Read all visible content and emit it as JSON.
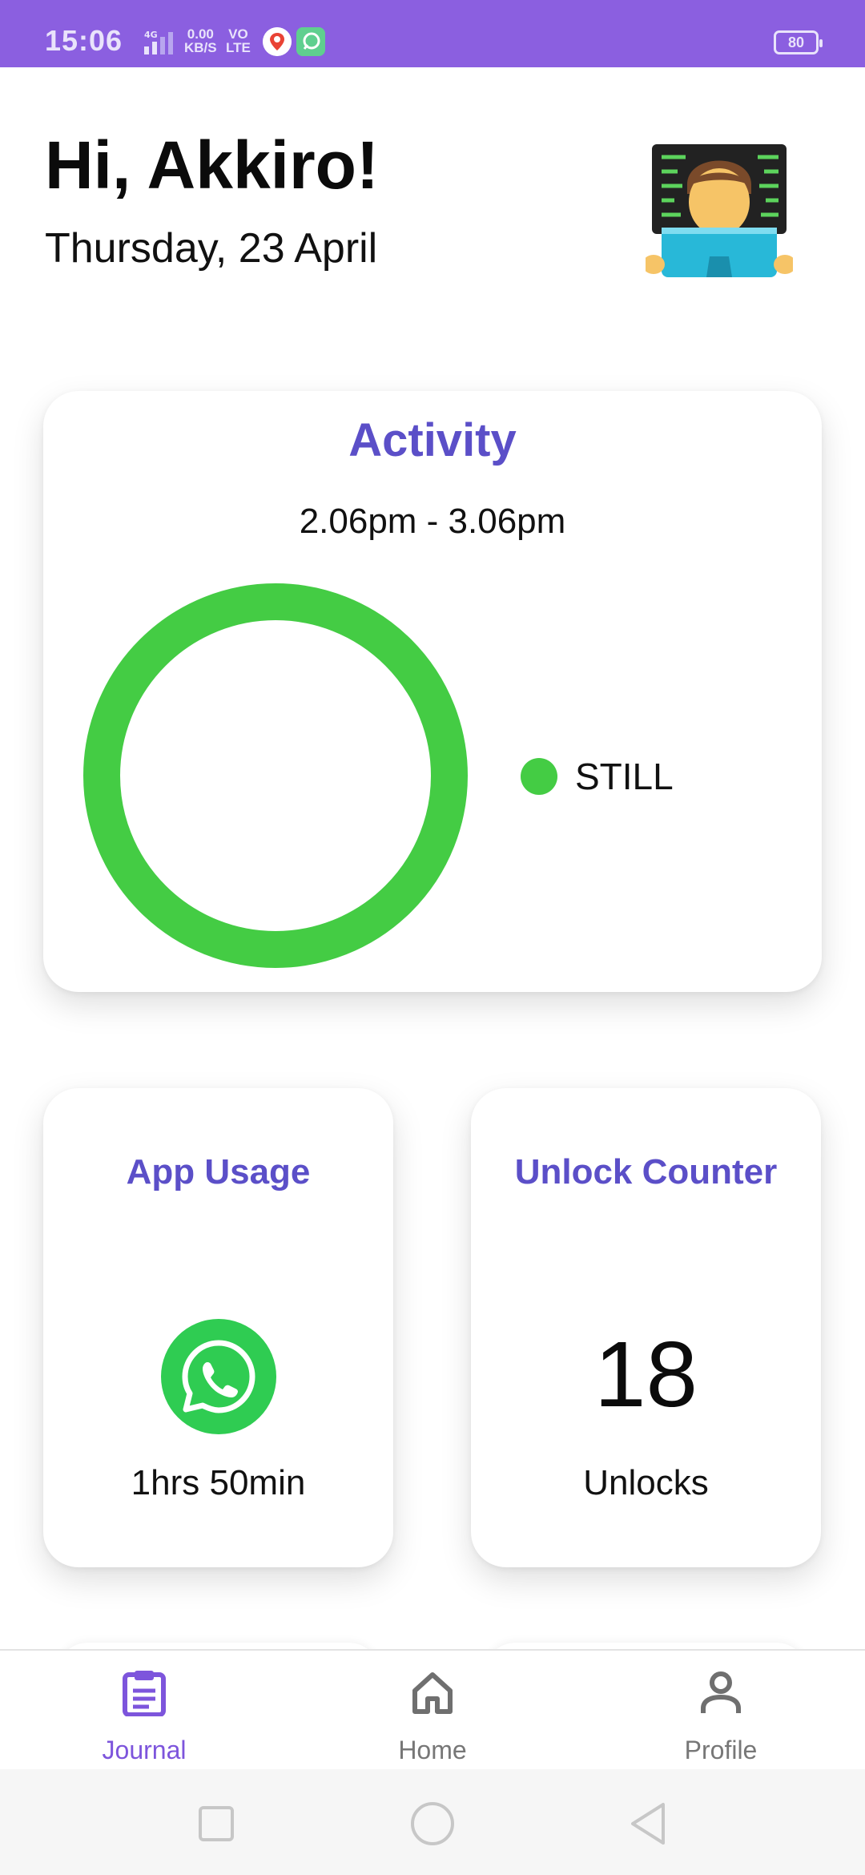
{
  "status_bar": {
    "time": "15:06",
    "network_speed_value": "0.00",
    "network_speed_unit": "KB/S",
    "volte_line1": "VO",
    "volte_line2": "LTE",
    "signal_type": "4G",
    "battery": "80"
  },
  "header": {
    "greeting": "Hi, Akkiro!",
    "date": "Thursday, 23 April",
    "avatar_icon": "technologist-emoji-icon"
  },
  "activity": {
    "title": "Activity",
    "time_range": "2.06pm - 3.06pm",
    "legend_label": "STILL",
    "color": "#44cc44"
  },
  "chart_data": {
    "type": "pie",
    "title": "Activity",
    "categories": [
      "STILL"
    ],
    "values": [
      100
    ],
    "legend": "right"
  },
  "app_usage": {
    "title": "App Usage",
    "app_icon": "whatsapp-icon",
    "duration": "1hrs 50min"
  },
  "unlock_counter": {
    "title": "Unlock Counter",
    "count": "18",
    "label": "Unlocks"
  },
  "bottom_nav": {
    "items": [
      {
        "label": "Journal",
        "icon": "clipboard-icon",
        "active": true
      },
      {
        "label": "Home",
        "icon": "home-icon",
        "active": false
      },
      {
        "label": "Profile",
        "icon": "person-icon",
        "active": false
      }
    ]
  },
  "colors": {
    "accent": "#8b5fe0",
    "title_purple": "#5b4fc8",
    "activity_green": "#44cc44",
    "whatsapp_green": "#2fcc52"
  }
}
